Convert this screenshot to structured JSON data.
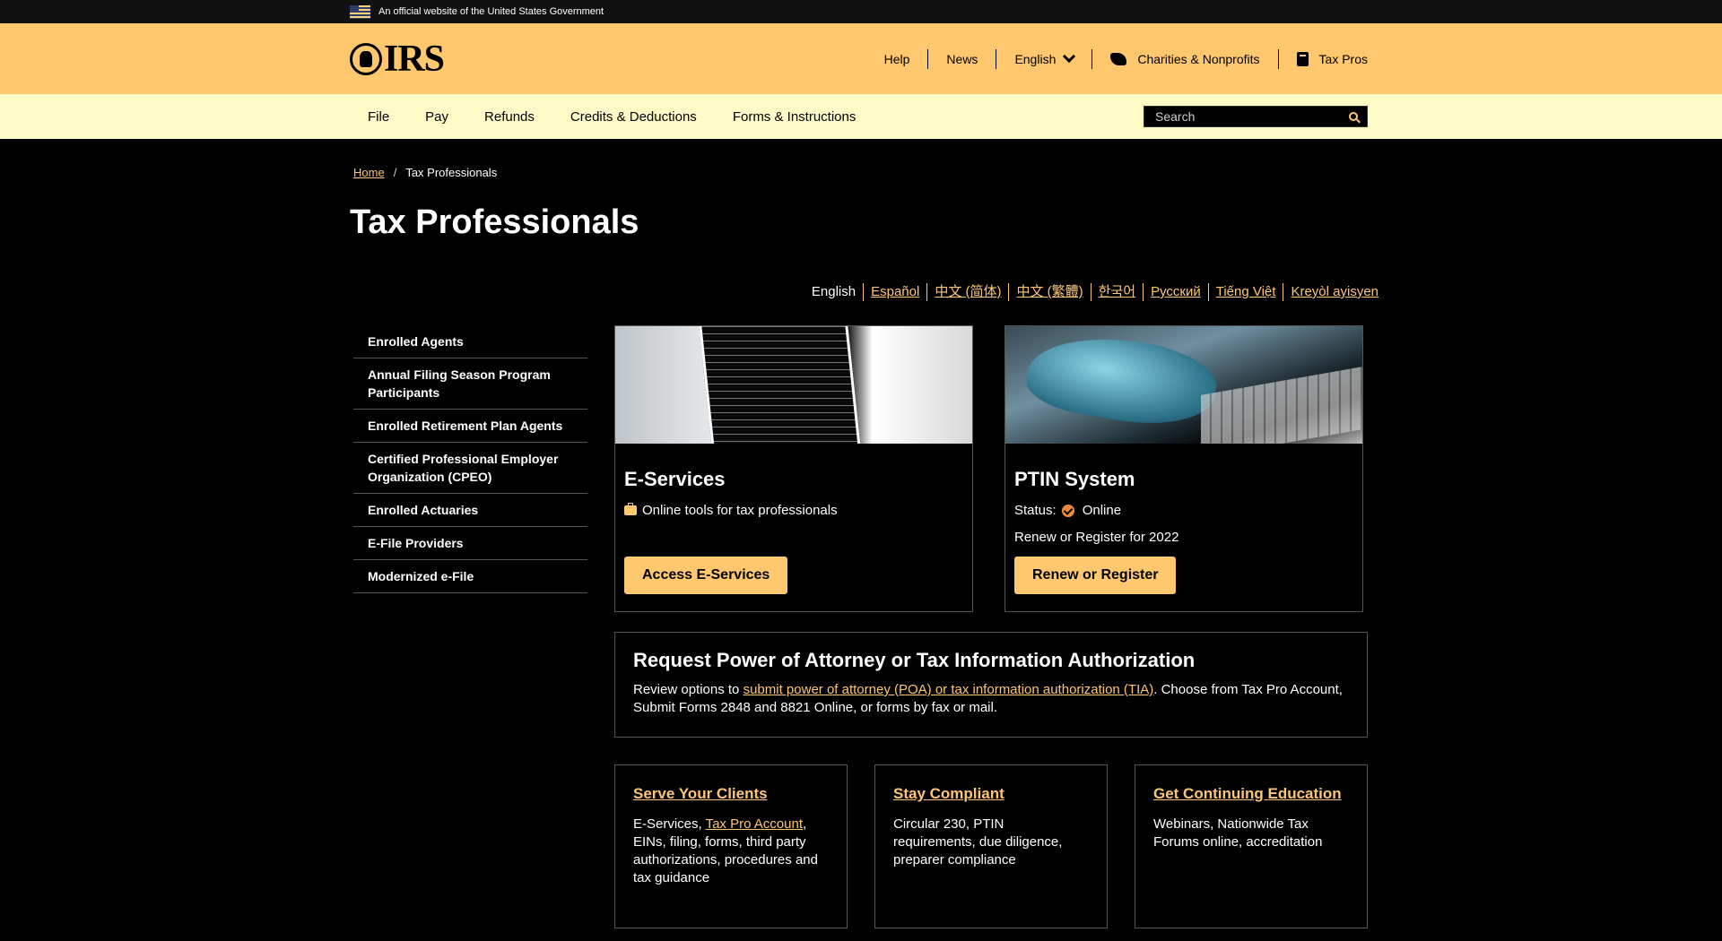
{
  "gov_banner": {
    "text": "An official website of the United States Government"
  },
  "header": {
    "logo_text": "IRS",
    "utility_links": {
      "help": "Help",
      "news": "News",
      "language": "English",
      "charities": "Charities & Nonprofits",
      "tax_pros": "Tax Pros"
    }
  },
  "nav": {
    "items": [
      "File",
      "Pay",
      "Refunds",
      "Credits & Deductions",
      "Forms & Instructions"
    ],
    "search_placeholder": "Search"
  },
  "breadcrumb": {
    "home": "Home",
    "separator": "/",
    "current": "Tax Professionals"
  },
  "page_title": "Tax Professionals",
  "languages": [
    "English",
    "Español",
    "中文 (简体)",
    "中文 (繁體)",
    "한국어",
    "Русский",
    "Tiếng Việt",
    "Kreyòl ayisyen"
  ],
  "sidebar": {
    "items": [
      "Enrolled Agents",
      "Annual Filing Season Program Participants",
      "Enrolled Retirement Plan Agents",
      "Certified Professional Employer Organization (CPEO)",
      "Enrolled Actuaries",
      "E-File Providers",
      "Modernized e-File"
    ]
  },
  "eservices": {
    "title": "E-Services",
    "description": "Online tools for tax professionals",
    "button": "Access E-Services",
    "icon": "briefcase-icon"
  },
  "ptin": {
    "title": "PTIN System",
    "status_label": "Status:",
    "status_value": "Online",
    "renew_text": "Renew or Register for 2022",
    "button": "Renew or Register",
    "icon": "check-circle-icon"
  },
  "poa": {
    "title": "Request Power of Attorney or Tax Information Authorization",
    "text_before": "Review options to ",
    "link": "submit power of attorney (POA) or tax information authorization (TIA)",
    "text_after": ". Choose from Tax Pro Account, Submit Forms 2848 and 8821 Online, or forms by fax or mail."
  },
  "cards": {
    "serve": {
      "title": "Serve Your Clients",
      "text_before": "E-Services, ",
      "link": "Tax Pro Account",
      "text_after": ", EINs, filing, forms, third party authorizations, procedures and tax guidance"
    },
    "compliant": {
      "title": "Stay Compliant",
      "text": "Circular 230, PTIN requirements, due diligence, preparer compliance"
    },
    "education": {
      "title": "Get Continuing Education",
      "text": "Webinars, Nationwide Tax Forums online, accreditation"
    }
  },
  "colors": {
    "header_bg": "#ffc86f",
    "nav_bg": "#fffbc6",
    "page_bg": "#000000",
    "link": "#fdc676",
    "button_bg": "#ffc86f"
  }
}
